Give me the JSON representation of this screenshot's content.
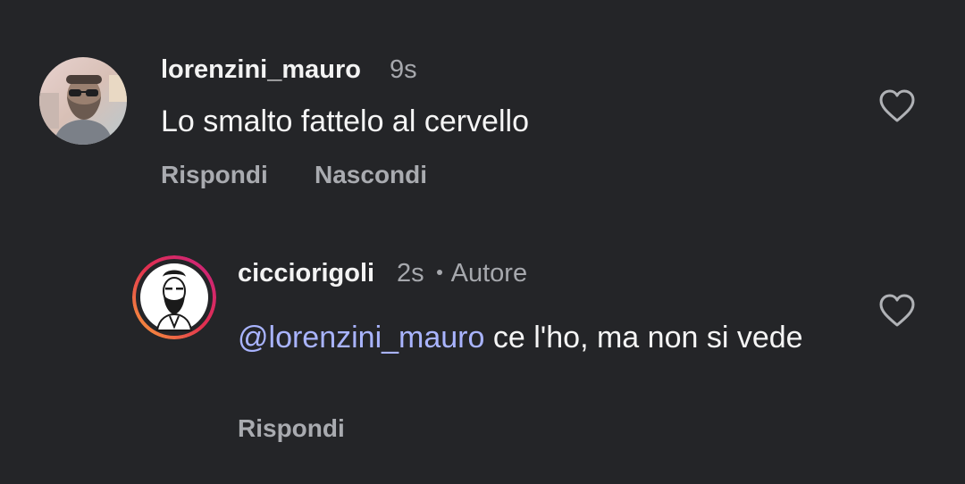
{
  "comments": [
    {
      "username": "lorenzini_mauro",
      "time": "9s",
      "text": "Lo smalto fattelo al cervello",
      "actions": {
        "reply": "Rispondi",
        "hide": "Nascondi"
      },
      "avatar_icon": "user-photo-avatar",
      "like_icon": "heart-outline-icon"
    },
    {
      "username": "cicciorigoli",
      "time": "2s",
      "author_badge": "Autore",
      "mention": "@lorenzini_mauro",
      "text": " ce l'ho, ma non si vede",
      "actions": {
        "reply": "Rispondi"
      },
      "avatar_icon": "bearded-man-illustration-avatar",
      "like_icon": "heart-outline-icon"
    }
  ],
  "colors": {
    "background": "#242528",
    "mention": "#a9b4ff",
    "secondary_text": "#a6a8ad",
    "story_ring_start": "#f9a13a",
    "story_ring_end": "#c9227f"
  }
}
